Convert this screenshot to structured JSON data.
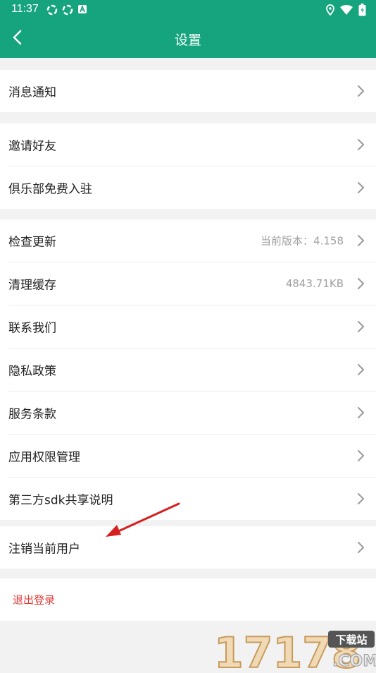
{
  "status_bar": {
    "time": "11:37"
  },
  "header": {
    "title": "设置"
  },
  "groups": [
    {
      "items": [
        {
          "label": "消息通知"
        }
      ]
    },
    {
      "items": [
        {
          "label": "邀请好友"
        },
        {
          "label": "俱乐部免费入驻"
        }
      ]
    },
    {
      "items": [
        {
          "label": "检查更新",
          "value": "当前版本：4.158"
        },
        {
          "label": "清理缓存",
          "value": "4843.71KB"
        },
        {
          "label": "联系我们"
        },
        {
          "label": "隐私政策"
        },
        {
          "label": "服务条款"
        },
        {
          "label": "应用权限管理"
        },
        {
          "label": "第三方sdk共享说明"
        }
      ]
    },
    {
      "items": [
        {
          "label": "注销当前用户"
        }
      ]
    }
  ],
  "logout": {
    "label": "退出登录"
  },
  "watermark": {
    "text": "17178",
    "sub": "下载站",
    "domain": ".COM"
  },
  "colors": {
    "brand": "#16a47e",
    "danger": "#e53935",
    "annotation_arrow": "#d62020"
  }
}
